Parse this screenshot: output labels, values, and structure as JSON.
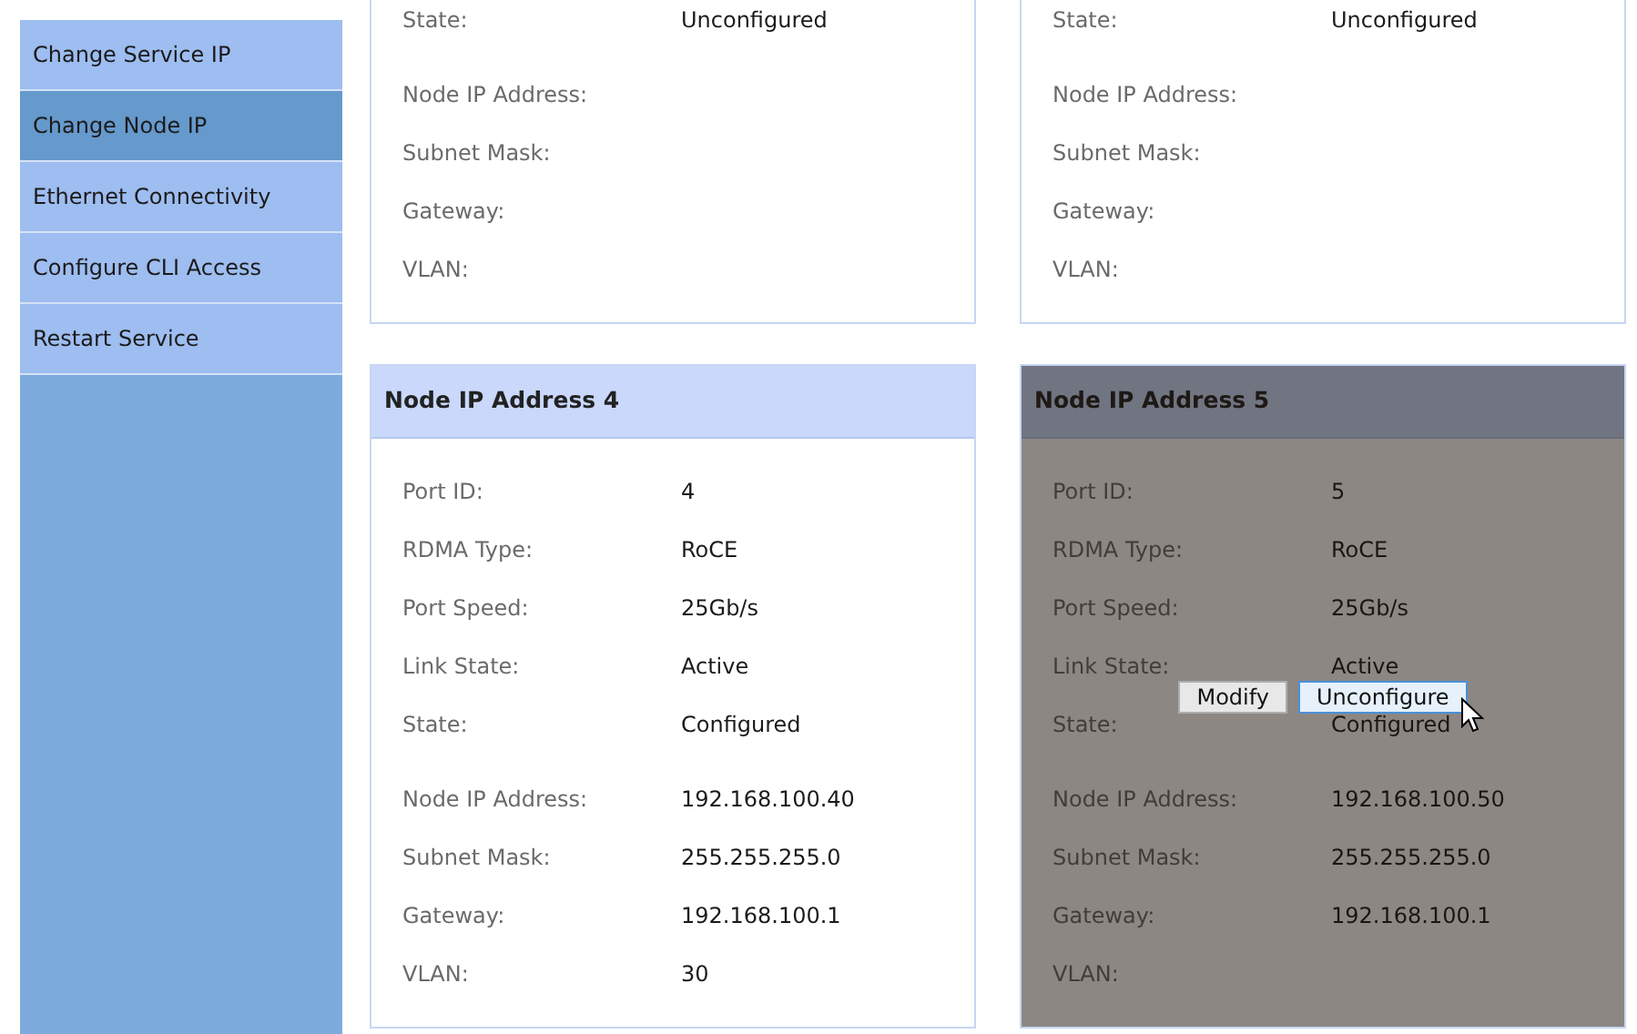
{
  "sidebar": {
    "items": [
      {
        "label": "Change Service IP",
        "selected": false
      },
      {
        "label": "Change Node IP",
        "selected": true
      },
      {
        "label": "Ethernet Connectivity",
        "selected": false
      },
      {
        "label": "Configure CLI Access",
        "selected": false
      },
      {
        "label": "Restart Service",
        "selected": false
      }
    ]
  },
  "cards": [
    {
      "hovered": false,
      "sections": [
        [
          {
            "label": "State:",
            "value": "Unconfigured"
          }
        ],
        [
          {
            "label": "Node IP Address:"
          },
          {
            "label": "Subnet Mask:"
          },
          {
            "label": "Gateway:"
          },
          {
            "label": "VLAN:"
          }
        ]
      ]
    },
    {
      "hovered": false,
      "sections": [
        [
          {
            "label": "State:",
            "value": "Unconfigured"
          }
        ],
        [
          {
            "label": "Node IP Address:"
          },
          {
            "label": "Subnet Mask:"
          },
          {
            "label": "Gateway:"
          },
          {
            "label": "VLAN:"
          }
        ]
      ]
    },
    {
      "title": "Node IP Address 4",
      "hovered": false,
      "sections": [
        [
          {
            "label": "Port ID:",
            "value": "4"
          },
          {
            "label": "RDMA Type:",
            "value": "RoCE"
          },
          {
            "label": "Port Speed:",
            "value": "25Gb/s"
          },
          {
            "label": "Link State:",
            "value": "Active"
          },
          {
            "label": "State:",
            "value": "Configured"
          }
        ],
        [
          {
            "label": "Node IP Address:",
            "value": "192.168.100.40"
          },
          {
            "label": "Subnet Mask:",
            "value": "255.255.255.0"
          },
          {
            "label": "Gateway:",
            "value": "192.168.100.1"
          },
          {
            "label": "VLAN:",
            "value": "30"
          }
        ]
      ]
    },
    {
      "title": "Node IP Address 5",
      "hovered": true,
      "actions": [
        {
          "label": "Modify",
          "hovered": false
        },
        {
          "label": "Unconfigure",
          "hovered": true
        }
      ],
      "sections": [
        [
          {
            "label": "Port ID:",
            "value": "5"
          },
          {
            "label": "RDMA Type:",
            "value": "RoCE"
          },
          {
            "label": "Port Speed:",
            "value": "25Gb/s"
          },
          {
            "label": "Link State:",
            "value": "Active"
          },
          {
            "label": "State:",
            "value": "Configured"
          }
        ],
        [
          {
            "label": "Node IP Address:",
            "value": "192.168.100.50"
          },
          {
            "label": "Subnet Mask:",
            "value": "255.255.255.0"
          },
          {
            "label": "Gateway:",
            "value": "192.168.100.1"
          },
          {
            "label": "VLAN:"
          }
        ]
      ]
    }
  ]
}
